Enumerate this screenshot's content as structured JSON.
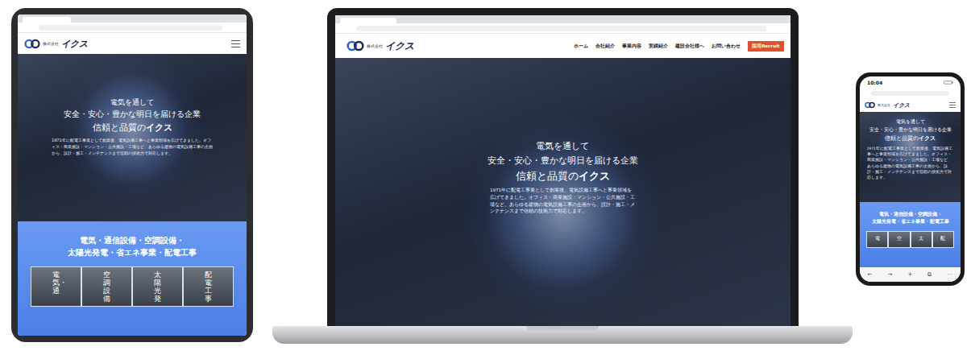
{
  "site": {
    "logo": {
      "prefix": "株式会社",
      "name": "イクス"
    },
    "nav": [
      {
        "label": "ホーム"
      },
      {
        "label": "会社紹介"
      },
      {
        "label": "事業内容"
      },
      {
        "label": "実績紹介"
      },
      {
        "label": "建設会社様へ"
      },
      {
        "label": "お問い合わせ"
      }
    ],
    "recruit_button": "採用Recruit",
    "hero": {
      "line1": "電気を通して",
      "line2": "安全・安心・豊かな明日を届ける企業",
      "line3": "信頼と品質の",
      "line3_emphasis": "イクス",
      "body": "1971年に配電工事業として創業後、電気設備工事へと事業領域を広げてきました。オフィス・商業施設・マンション・公共施設・工場など、あらゆる建物の電気設備工事の企画から、設計・施工・メンテナンスまで信頼の技術力で対応します。"
    },
    "services": {
      "line1": "電気・通信設備・空調設備・",
      "line2": "太陽光発電・省エネ事業・配電工事"
    }
  },
  "tablet": {
    "service_cards": [
      "電気・通",
      "空調設備",
      "太陽光発",
      "配電工事"
    ]
  },
  "phone": {
    "time": "10:04",
    "service_cards": [
      "電",
      "空",
      "太",
      "配"
    ],
    "toolbar": [
      "←",
      "→",
      "+",
      "⧉",
      "⋯"
    ]
  }
}
